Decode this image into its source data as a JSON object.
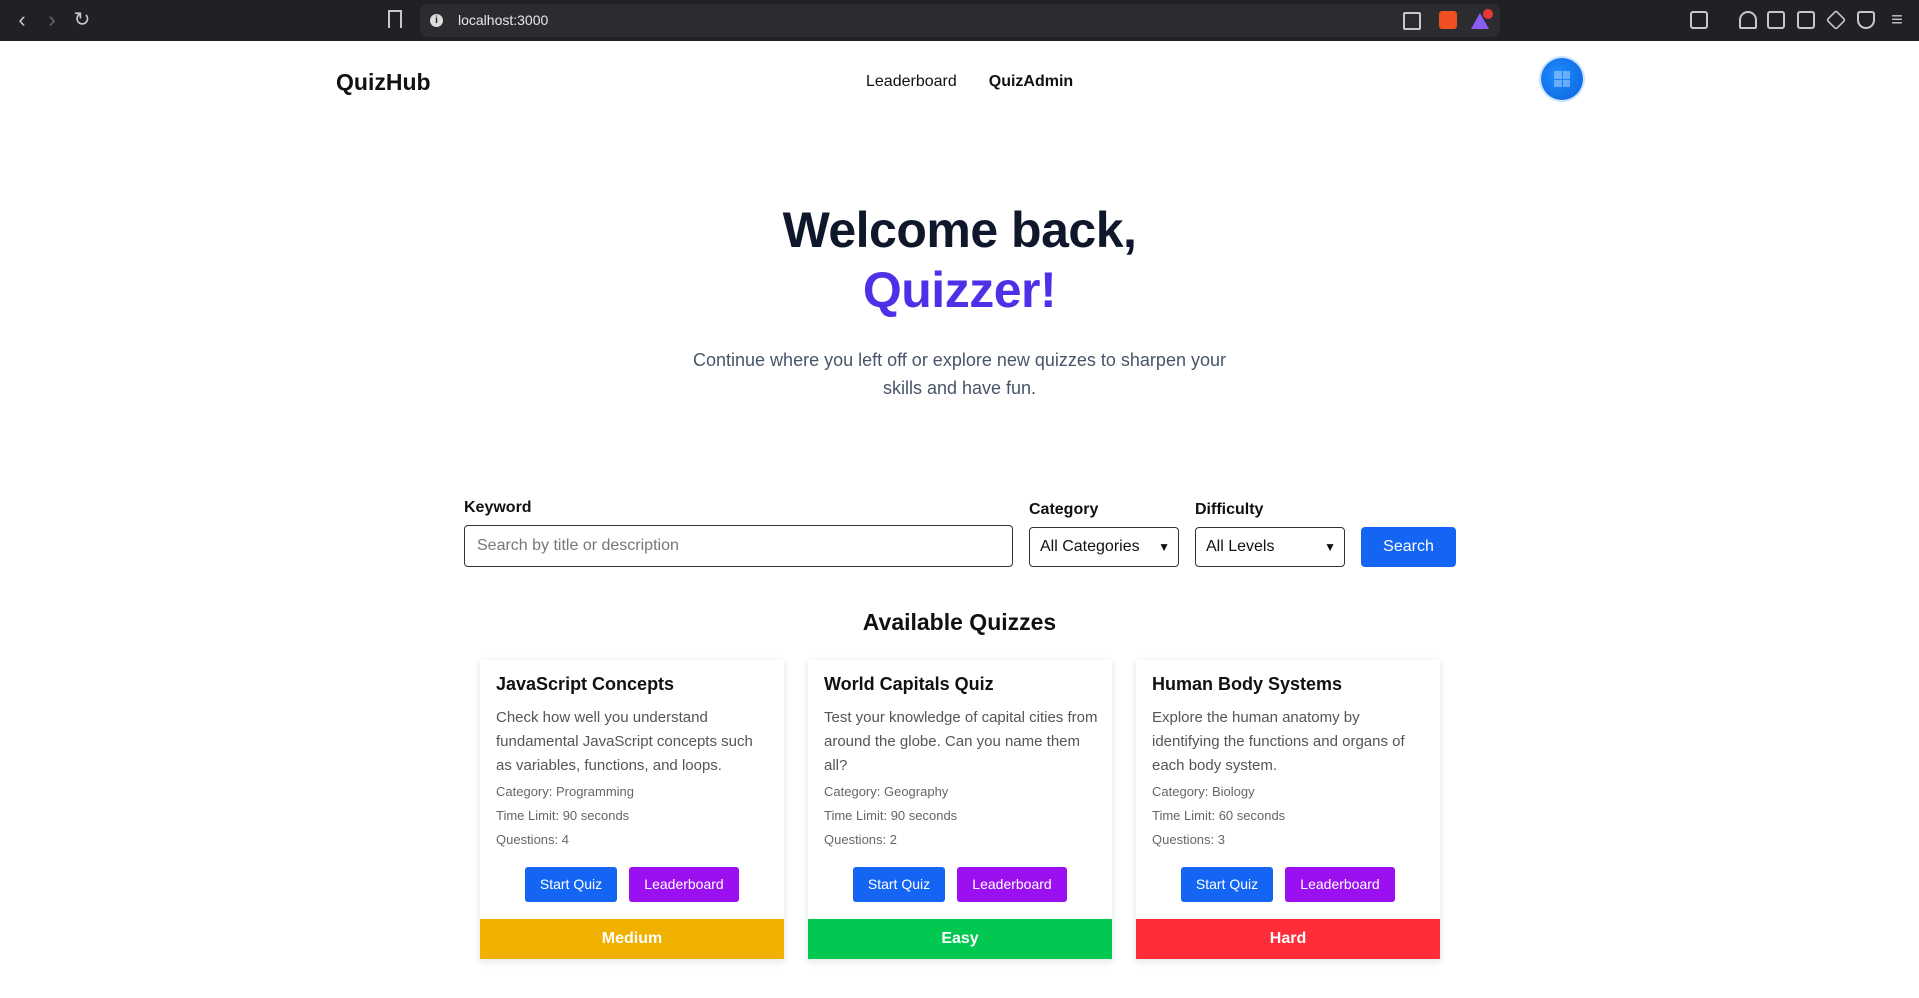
{
  "browser": {
    "url": "localhost:3000"
  },
  "header": {
    "brand": "QuizHub",
    "nav": [
      "Leaderboard",
      "QuizAdmin"
    ]
  },
  "hero": {
    "line1": "Welcome back,",
    "line2": "Quizzer!",
    "subtitle": "Continue where you left off or explore new quizzes to sharpen your skills and have fun."
  },
  "search": {
    "keyword_label": "Keyword",
    "keyword_placeholder": "Search by title or description",
    "keyword_value": "",
    "category_label": "Category",
    "category_selected": "All Categories",
    "difficulty_label": "Difficulty",
    "difficulty_selected": "All Levels",
    "button": "Search"
  },
  "quizzes": {
    "title": "Available Quizzes",
    "start_label": "Start Quiz",
    "board_label": "Leaderboard",
    "items": [
      {
        "title": "JavaScript Concepts",
        "description": "Check how well you understand fundamental JavaScript concepts such as variables, functions, and loops.",
        "category": "Category: Programming",
        "time_limit": "Time Limit: 90 seconds",
        "questions": "Questions: 4",
        "difficulty": "Medium",
        "difficulty_color": "#f0b000"
      },
      {
        "title": "World Capitals Quiz",
        "description": "Test your knowledge of capital cities from around the globe. Can you name them all?",
        "category": "Category: Geography",
        "time_limit": "Time Limit: 90 seconds",
        "questions": "Questions: 2",
        "difficulty": "Easy",
        "difficulty_color": "#00c850"
      },
      {
        "title": "Human Body Systems",
        "description": "Explore the human anatomy by identifying the functions and organs of each body system.",
        "category": "Category: Biology",
        "time_limit": "Time Limit: 60 seconds",
        "questions": "Questions: 3",
        "difficulty": "Hard",
        "difficulty_color": "#ff2d3a"
      }
    ]
  }
}
